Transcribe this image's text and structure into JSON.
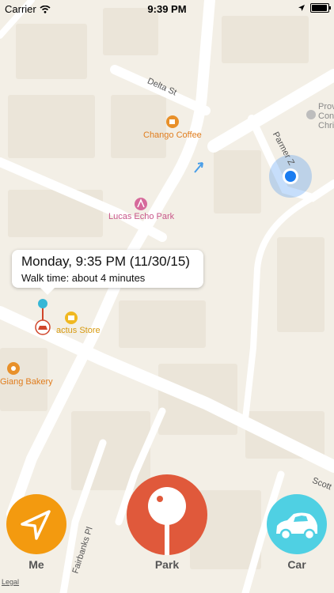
{
  "status_bar": {
    "carrier": "Carrier",
    "time": "9:39 PM"
  },
  "map": {
    "streets": {
      "delta": "Delta St",
      "parmer": "Parmer Z",
      "scott": "Scott",
      "fairbanks": "Fairbanks Pl"
    },
    "pois": {
      "chango": "Chango Coffee",
      "lucas": "Lucas Echo Park",
      "cactus": "actus Store",
      "giang": "Giang Bakery",
      "church_line1": "Prov",
      "church_line2": "Con",
      "church_line3": "Chri"
    },
    "legal": "Legal"
  },
  "callout": {
    "title": "Monday, 9:35 PM (11/30/15)",
    "subtitle": "Walk time: about 4 minutes"
  },
  "buttons": {
    "me": "Me",
    "park": "Park",
    "car": "Car"
  },
  "colors": {
    "me": "#f39a0f",
    "park": "#e0593b",
    "car": "#4fd0e3",
    "user_location": "#1a7cf0",
    "poi_orange": "#e8902a",
    "poi_pink": "#d66a9b"
  }
}
